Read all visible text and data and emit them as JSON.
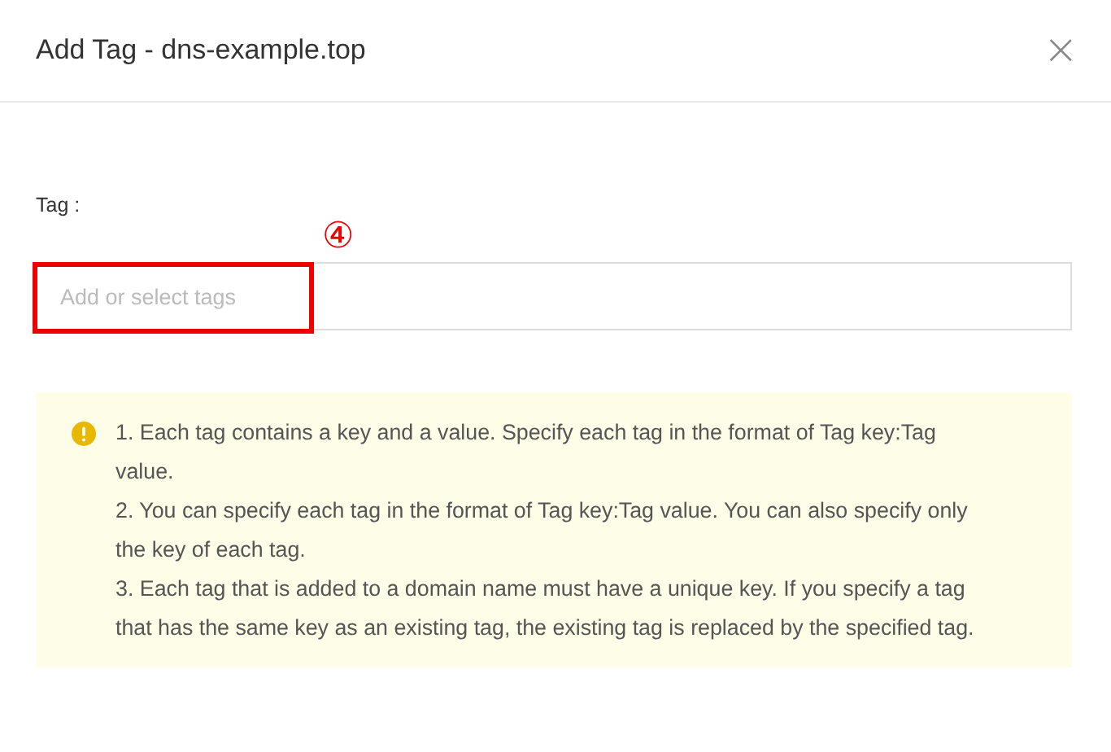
{
  "dialog": {
    "title": "Add Tag - dns-example.top",
    "close": "×"
  },
  "form": {
    "label": "Tag :",
    "field": {
      "placeholder": "Add or select tags"
    }
  },
  "annotation": {
    "label": "④"
  },
  "notice": {
    "items": [
      "1. Each tag contains a key and a value. Specify each tag in the format of Tag key:Tag value.",
      "2. You can specify each tag in the format of Tag key:Tag value. You can also specify only the key of each tag.",
      "3. Each tag that is added to a domain name must have a unique key. If you specify a tag that has the same key as an existing tag, the existing tag is replaced by the specified tag."
    ]
  }
}
